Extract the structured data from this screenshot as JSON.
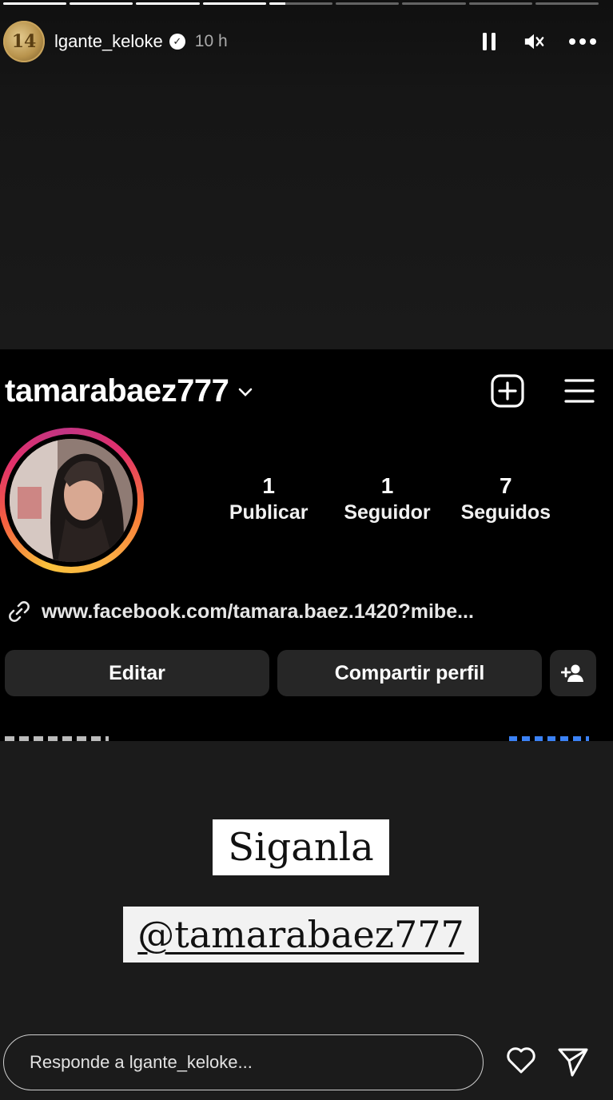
{
  "story": {
    "progress_segments": [
      1,
      1,
      1,
      1,
      0.25,
      0,
      0,
      0,
      0
    ],
    "username": "lgante_keloke",
    "avatar_text": "14",
    "time_ago": "10 h",
    "icons": [
      "verified-badge-icon",
      "pause-icon",
      "mute-icon",
      "more-options-icon"
    ]
  },
  "profile": {
    "username": "tamarabaez777",
    "stats": [
      {
        "value": "1",
        "label": "Publicar"
      },
      {
        "value": "1",
        "label": "Seguidor"
      },
      {
        "value": "7",
        "label": "Seguidos"
      }
    ],
    "link": "www.facebook.com/tamara.baez.1420?mibe...",
    "buttons": {
      "edit": "Editar",
      "share": "Compartir perfil"
    },
    "icons": [
      "chevron-down-icon",
      "new-post-icon",
      "menu-icon",
      "link-icon",
      "add-user-icon"
    ]
  },
  "stickers": {
    "line1": "Siganla",
    "line2": "@tamarabaez777"
  },
  "reply": {
    "placeholder": "Responde a lgante_keloke...",
    "icons": [
      "heart-icon",
      "send-icon"
    ]
  },
  "colors": {
    "story_bg": "#1b1b1b",
    "profile_bg": "#000000",
    "button_bg": "#262626",
    "ring_gradient": [
      "#f9c23c",
      "#f56040",
      "#e1306c",
      "#c13584"
    ]
  }
}
